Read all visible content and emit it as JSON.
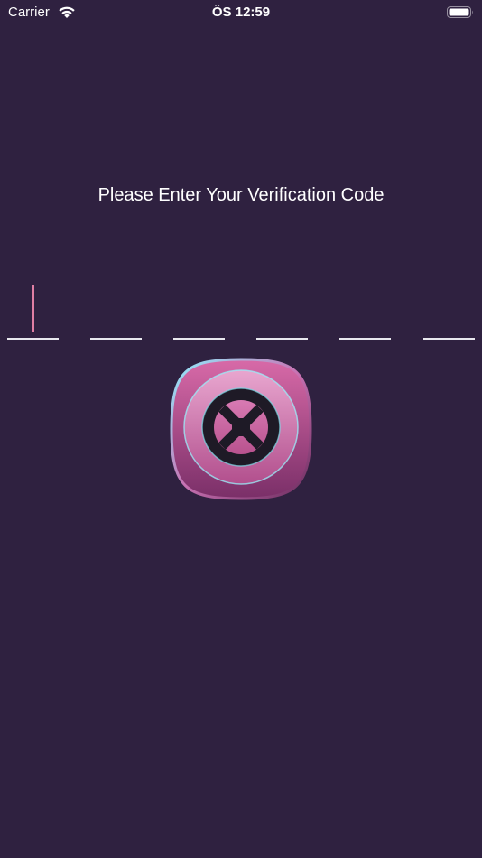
{
  "status_bar": {
    "carrier": "Carrier",
    "time": "ÖS 12:59",
    "wifi_icon": "wifi-icon",
    "battery_icon": "battery-icon"
  },
  "verification": {
    "heading": "Please Enter Your Verification Code",
    "code_length": 6,
    "digits": [
      "",
      "",
      "",
      "",
      "",
      ""
    ],
    "active_index": 0
  },
  "logo": {
    "icon": "app-logo-icon"
  },
  "colors": {
    "background": "#2f2140",
    "caret": "#e07fa4",
    "underline": "#e8e8ee",
    "logo_pink": "#c85c97",
    "logo_accent": "#7fe0f0"
  }
}
